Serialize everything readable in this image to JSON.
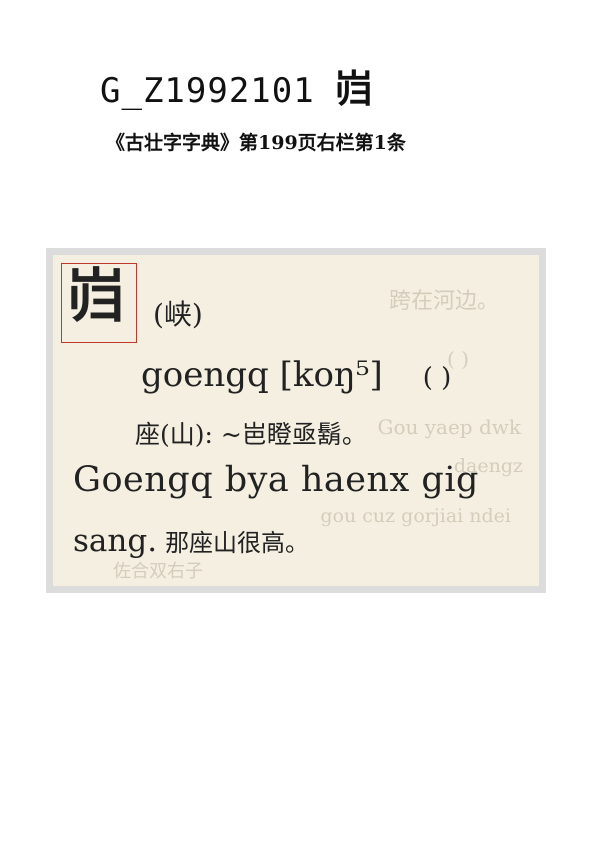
{
  "header": {
    "code": "G_Z1992101",
    "glyph": "岿"
  },
  "source": {
    "citation": "《古壮字字典》第199页右栏第1条"
  },
  "entry": {
    "char": "岿",
    "variant": "(峡)",
    "pronunciation": "goengq [koŋ⁵]",
    "pronunciation_extra": "(  )",
    "gloss": "座(山): ~岜瞪亟鬍。",
    "example_line1": "Goengq bya haenx gig",
    "example_line2_latin": "sang.",
    "example_line2_zh": "那座山很高。"
  },
  "bleed_through": {
    "line1": "跨在河边。",
    "line2": "(  )",
    "line3": "Gou yaep dwk",
    "line4": "daengz",
    "line5": "gou cuz gorjiai ndei",
    "line6": "佐合双右子"
  }
}
